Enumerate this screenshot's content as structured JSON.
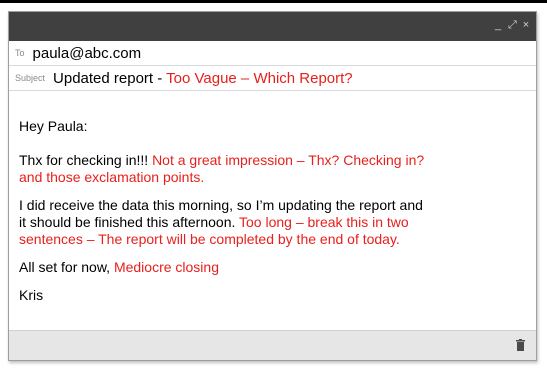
{
  "window": {
    "controls": {
      "minimize": "_",
      "expand": "⤢",
      "close": "×"
    }
  },
  "to": {
    "label": "To",
    "value": "paula@abc.com"
  },
  "subject": {
    "label": "Subject",
    "value": "Updated report - ",
    "critique": "Too Vague – Which Report?"
  },
  "body": {
    "greeting": "Hey Paula:",
    "p1_text": "Thx for checking in!!! ",
    "p1_critique": "Not a great impression – Thx? Checking in? and those exclamation points.",
    "p2_text": " I did receive the data this morning, so I’m updating the report and it should be finished this afternoon. ",
    "p2_critique": "Too long – break this in two sentences – The report will be completed by the end of today.",
    "p3_text": "All set for now, ",
    "p3_critique": "Mediocre closing",
    "signature": "Kris"
  },
  "footer": {
    "icon": "trash-icon"
  },
  "colors": {
    "titlebar": "#404040",
    "critique": "#e8201d",
    "footer": "#e6e6e6"
  }
}
